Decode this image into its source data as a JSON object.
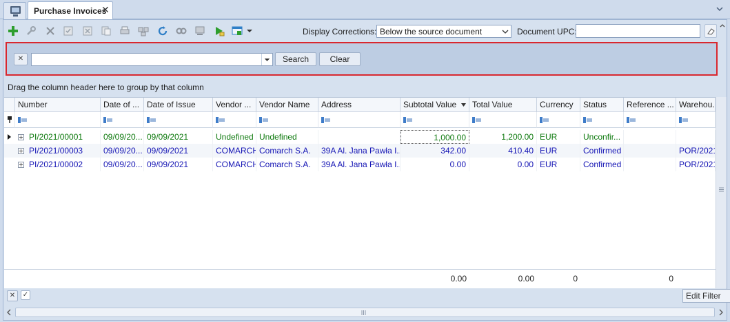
{
  "tab": {
    "title": "Purchase Invoices",
    "close": "✕"
  },
  "toolbar": {
    "display_corrections_label": "Display Corrections:",
    "display_corrections_value": "Below the source document",
    "document_upc_label": "Document UPC:",
    "document_upc_value": ""
  },
  "filter": {
    "search_label": "Search",
    "clear_label": "Clear",
    "value": ""
  },
  "group_hint": "Drag the column header here to group by that column",
  "grid": {
    "columns": [
      "Number",
      "Date of ...",
      "Date of Issue",
      "Vendor ...",
      "Vendor Name",
      "Address",
      "Subtotal Value",
      "Total Value",
      "Currency",
      "Status",
      "Reference ...",
      "Warehou..."
    ],
    "rows": [
      [
        "PI/2021/00001",
        "09/09/20...",
        "09/09/2021",
        "Undefined",
        "Undefined",
        "",
        "1,000.00",
        "1,200.00",
        "EUR",
        "Unconfir...",
        "",
        ""
      ],
      [
        "PI/2021/00003",
        "09/09/20...",
        "09/09/2021",
        "COMARCH",
        "Comarch S.A.",
        "39A Al. Jana Pawła I...",
        "342.00",
        "410.40",
        "EUR",
        "Confirmed",
        "",
        "POR/2021"
      ],
      [
        "PI/2021/00002",
        "09/09/20...",
        "09/09/2021",
        "COMARCH",
        "Comarch S.A.",
        "39A Al. Jana Pawła I...",
        "0.00",
        "0.00",
        "EUR",
        "Confirmed",
        "",
        "POR/2021"
      ]
    ],
    "summary": {
      "subtotal": "0.00",
      "total": "0.00",
      "currency": "0",
      "reference": "0"
    }
  },
  "bottom": {
    "edit_filter": "Edit Filter"
  },
  "colors": {
    "accent_green": "#0f7a0f",
    "accent_blue": "#1414b4",
    "highlight_red": "#d9272e"
  }
}
